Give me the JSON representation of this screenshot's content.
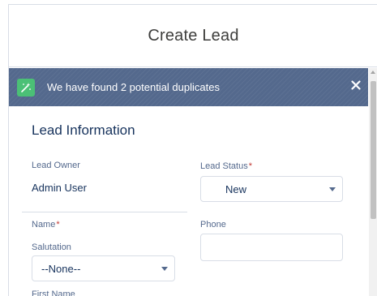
{
  "modal": {
    "title": "Create Lead"
  },
  "duplicates_banner": {
    "message": "We have found 2 potential duplicates",
    "icon": "magic-wand-icon",
    "close_icon": "close-icon",
    "accent_color": "#4bc076"
  },
  "section": {
    "title": "Lead Information"
  },
  "fields": {
    "lead_owner": {
      "label": "Lead Owner",
      "value": "Admin User"
    },
    "lead_status": {
      "label": "Lead Status",
      "required_mark": "*",
      "selected": "New"
    },
    "name": {
      "label": "Name",
      "required_mark": "*"
    },
    "phone": {
      "label": "Phone",
      "value": ""
    },
    "salutation": {
      "label": "Salutation",
      "selected": "--None--"
    },
    "first_name": {
      "label": "First Name"
    }
  }
}
